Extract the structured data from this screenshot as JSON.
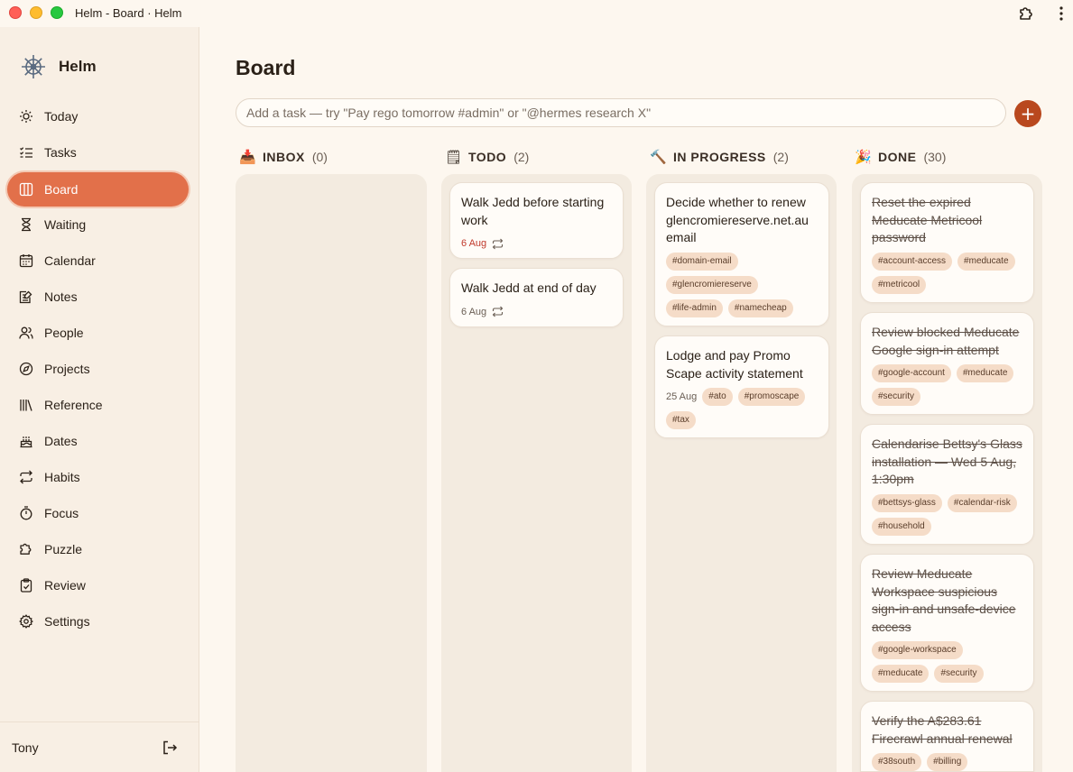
{
  "window": {
    "title": "Helm - Board · Helm"
  },
  "brand": {
    "name": "Helm"
  },
  "sidebar": {
    "items": [
      {
        "label": "Today",
        "icon": "sun-icon"
      },
      {
        "label": "Tasks",
        "icon": "checklist-icon"
      },
      {
        "label": "Board",
        "icon": "columns-icon",
        "active": true
      },
      {
        "label": "Waiting",
        "icon": "hourglass-icon"
      },
      {
        "label": "Calendar",
        "icon": "calendar-icon"
      },
      {
        "label": "Notes",
        "icon": "notes-icon"
      },
      {
        "label": "People",
        "icon": "people-icon"
      },
      {
        "label": "Projects",
        "icon": "compass-icon"
      },
      {
        "label": "Reference",
        "icon": "library-icon"
      },
      {
        "label": "Dates",
        "icon": "cake-icon"
      },
      {
        "label": "Habits",
        "icon": "repeat-icon"
      },
      {
        "label": "Focus",
        "icon": "stopwatch-icon"
      },
      {
        "label": "Puzzle",
        "icon": "puzzle-icon"
      },
      {
        "label": "Review",
        "icon": "clipboard-check-icon"
      },
      {
        "label": "Settings",
        "icon": "gear-icon"
      }
    ],
    "user": "Tony"
  },
  "main": {
    "title": "Board",
    "add_task": {
      "placeholder": "Add a task — try \"Pay rego tomorrow #admin\" or \"@hermes research X\"",
      "button": "+"
    }
  },
  "columns": [
    {
      "emoji": "📥",
      "name": "INBOX",
      "count": "(0)",
      "cards": []
    },
    {
      "emoji": "🗒",
      "name": "TODO",
      "count": "(2)",
      "cards": [
        {
          "title": "Walk Jedd before starting work",
          "date": "6 Aug",
          "overdue": true,
          "repeat": true,
          "tags": []
        },
        {
          "title": "Walk Jedd at end of day",
          "date": "6 Aug",
          "overdue": false,
          "repeat": true,
          "tags": []
        }
      ]
    },
    {
      "emoji": "🔨",
      "name": "IN PROGRESS",
      "count": "(2)",
      "cards": [
        {
          "title": "Decide whether to renew glencromiereserve.net.au email",
          "date": "",
          "repeat": false,
          "tags": [
            "#domain-email",
            "#glencromiereserve",
            "#life-admin",
            "#namecheap"
          ]
        },
        {
          "title": "Lodge and pay Promo Scape activity statement",
          "date": "25 Aug",
          "repeat": false,
          "tags": [
            "#ato",
            "#promoscape",
            "#tax"
          ]
        }
      ]
    },
    {
      "emoji": "🎉",
      "name": "DONE",
      "count": "(30)",
      "cards": [
        {
          "title": "Reset the expired Meducate Metricool password",
          "tags": [
            "#account-access",
            "#meducate",
            "#metricool"
          ]
        },
        {
          "title": "Review blocked Meducate Google sign-in attempt",
          "tags": [
            "#google-account",
            "#meducate",
            "#security"
          ]
        },
        {
          "title": "Calendarise Bettsy's Glass installation — Wed 5 Aug, 1:30pm",
          "tags": [
            "#bettsys-glass",
            "#calendar-risk",
            "#household"
          ]
        },
        {
          "title": "Review Meducate Workspace suspicious sign-in and unsafe-device access",
          "tags": [
            "#google-workspace",
            "#meducate",
            "#security"
          ]
        },
        {
          "title": "Verify the A$283.61 Firecrawl annual renewal",
          "tags": [
            "#38south",
            "#billing"
          ]
        }
      ]
    }
  ]
}
